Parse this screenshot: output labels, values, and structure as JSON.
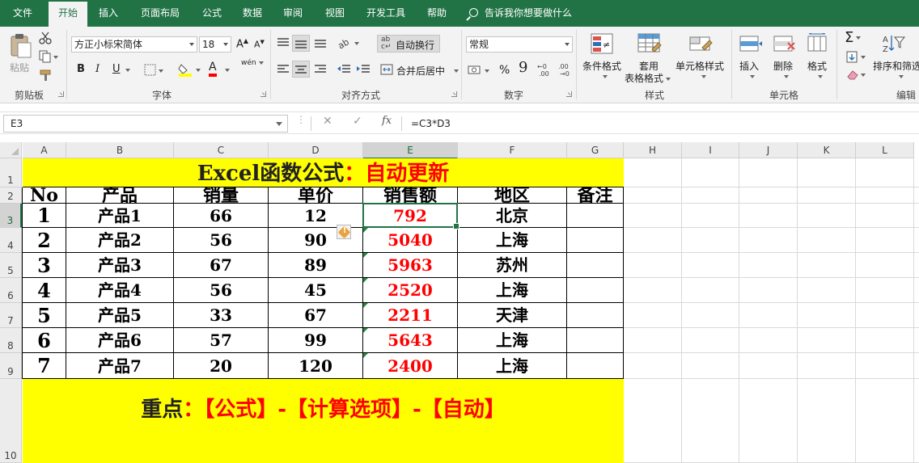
{
  "ribbon_tabs": [
    "文件",
    "开始",
    "插入",
    "页面布局",
    "公式",
    "数据",
    "审阅",
    "视图",
    "开发工具",
    "帮助"
  ],
  "active_tab": "开始",
  "tell_me": "告诉我你想要做什么",
  "clipboard": {
    "paste": "粘贴",
    "group": "剪贴板"
  },
  "font": {
    "name": "方正小标宋简体",
    "size": "18",
    "group": "字体",
    "bold": "B",
    "italic": "I",
    "underline": "U",
    "grow": "A",
    "shrink": "A",
    "color_glyph": "A",
    "pinyin": "wén"
  },
  "alignment": {
    "wrap": "自动换行",
    "merge": "合并后居中",
    "group": "对齐方式"
  },
  "number": {
    "format": "常规",
    "group": "数字",
    "percent": "%",
    "comma": "9"
  },
  "styles": {
    "conditional": "条件格式",
    "table_format_1": "套用",
    "table_format_2": "表格格式",
    "cell_styles": "单元格样式",
    "group": "样式"
  },
  "cells": {
    "insert": "插入",
    "delete": "删除",
    "format": "格式",
    "group": "单元格"
  },
  "editing": {
    "sort": "排序和筛选",
    "group": "编辑",
    "sum": "Σ"
  },
  "formula_bar": {
    "name_box": "E3",
    "cancel": "✕",
    "enter": "✓",
    "fx": "fx",
    "formula": "=C3*D3"
  },
  "columns": [
    "A",
    "B",
    "C",
    "D",
    "E",
    "F",
    "G",
    "H",
    "I",
    "J",
    "K",
    "L"
  ],
  "rows": [
    "1",
    "2",
    "3",
    "4",
    "5",
    "6",
    "7",
    "8",
    "9",
    "10"
  ],
  "sheet": {
    "title_black": "Excel函数公式",
    "title_red": "：自动更新",
    "headers": [
      "No",
      "产品",
      "销量",
      "单价",
      "销售额",
      "地区",
      "备注"
    ],
    "data": [
      [
        "1",
        "产品1",
        "66",
        "12",
        "792",
        "北京",
        ""
      ],
      [
        "2",
        "产品2",
        "56",
        "90",
        "5040",
        "上海",
        ""
      ],
      [
        "3",
        "产品3",
        "67",
        "89",
        "5963",
        "苏州",
        ""
      ],
      [
        "4",
        "产品4",
        "56",
        "45",
        "2520",
        "上海",
        ""
      ],
      [
        "5",
        "产品5",
        "33",
        "67",
        "2211",
        "天津",
        ""
      ],
      [
        "6",
        "产品6",
        "57",
        "99",
        "5643",
        "上海",
        ""
      ],
      [
        "7",
        "产品7",
        "20",
        "120",
        "2400",
        "上海",
        ""
      ]
    ],
    "footer_black": "重点",
    "footer_red": "：【公式】-【计算选项】-【自动】",
    "warning_glyph": "!"
  },
  "colors": {
    "ribbon_green": "#217346",
    "highlight_yellow": "#ffff00",
    "result_red": "#ff0000"
  }
}
